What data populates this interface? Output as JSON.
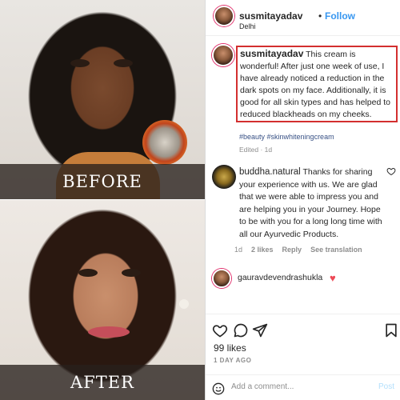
{
  "photos": {
    "before_label": "BEFORE",
    "after_label": "AFTER"
  },
  "post": {
    "username": "susmitayadav",
    "follow_dot": "•",
    "follow_label": "Follow",
    "location": "Delhi"
  },
  "caption": {
    "username": "susmitayadav",
    "text": "This cream is wonderful! After just one week of use, I have already noticed a reduction in the dark spots on my face. Additionally, it is good for all skin types and has helped to reduced blackheads on my cheeks.",
    "hashtags": "#beauty #skinwhiteningcream",
    "edited": "Edited · 1d"
  },
  "reply": {
    "username": "buddha.natural",
    "text": "Thanks for sharing your experience with us. We are glad that we were able to impress you and are helping you in your Journey. Hope to be with you for a long long time with all our Ayurvedic Products.",
    "time": "1d",
    "likes": "2 likes",
    "reply_label": "Reply",
    "translate_label": "See translation"
  },
  "mention": {
    "username": "gauravdevendrashukla",
    "emoji": "♥"
  },
  "actions": {
    "likes": "99 likes",
    "timestamp": "1 DAY AGO"
  },
  "comment_box": {
    "placeholder": "Add a comment...",
    "post_label": "Post"
  },
  "colors": {
    "accent": "#3897f0",
    "highlight_border": "#d32f2f",
    "heart": "#ed4956"
  }
}
